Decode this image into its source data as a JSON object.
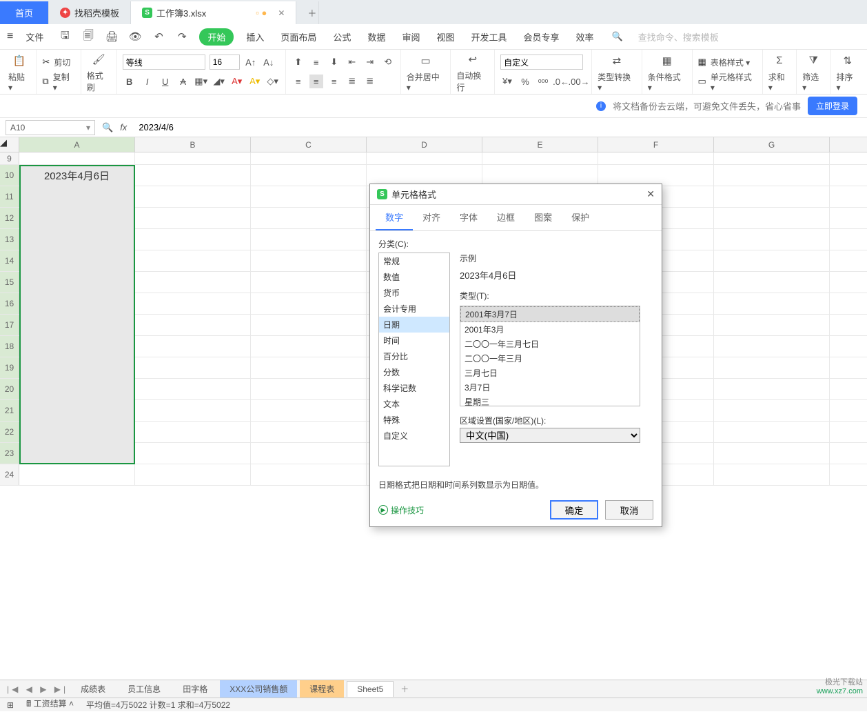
{
  "tabs": {
    "home": "首页",
    "templates": "找稻壳模板",
    "workbook": "工作簿3.xlsx"
  },
  "menubar": {
    "file": "文件",
    "items": [
      "开始",
      "插入",
      "页面布局",
      "公式",
      "数据",
      "审阅",
      "视图",
      "开发工具",
      "会员专享",
      "效率"
    ],
    "search_placeholder": "查找命令、搜索模板"
  },
  "ribbon": {
    "paste": "粘贴",
    "cut": "剪切",
    "copy": "复制",
    "format_painter": "格式刷",
    "font_name": "等线",
    "font_size": "16",
    "merge": "合并居中",
    "wrap": "自动换行",
    "number_format": "自定义",
    "type_convert": "类型转换",
    "cond_format": "条件格式",
    "table_style": "表格样式",
    "cell_style": "单元格样式",
    "sum": "求和",
    "filter": "筛选",
    "sort": "排序"
  },
  "banner": {
    "text": "将文档备份去云端，可避免文件丢失，省心省事",
    "login": "立即登录"
  },
  "fxbar": {
    "name": "A10",
    "formula": "2023/4/6"
  },
  "grid": {
    "columns": [
      "A",
      "B",
      "C",
      "D",
      "E",
      "F",
      "G"
    ],
    "rows": [
      9,
      10,
      11,
      12,
      13,
      14,
      15,
      16,
      17,
      18,
      19,
      20,
      21,
      22,
      23,
      24
    ],
    "a10_value": "2023年4月6日"
  },
  "dialog": {
    "title": "单元格格式",
    "tabs": [
      "数字",
      "对齐",
      "字体",
      "边框",
      "图案",
      "保护"
    ],
    "category_label": "分类(C):",
    "categories": [
      "常规",
      "数值",
      "货币",
      "会计专用",
      "日期",
      "时间",
      "百分比",
      "分数",
      "科学记数",
      "文本",
      "特殊",
      "自定义"
    ],
    "selected_category": "日期",
    "sample_label": "示例",
    "sample_value": "2023年4月6日",
    "type_label": "类型(T):",
    "types": [
      "2001年3月7日",
      "2001年3月",
      "二〇〇一年三月七日",
      "二〇〇一年三月",
      "三月七日",
      "3月7日",
      "星期三"
    ],
    "selected_type": "2001年3月7日",
    "locale_label": "区域设置(国家/地区)(L):",
    "locale_value": "中文(中国)",
    "note": "日期格式把日期和时间系列数显示为日期值。",
    "tips": "操作技巧",
    "ok": "确定",
    "cancel": "取消"
  },
  "sheettabs": {
    "tabs": [
      "成绩表",
      "员工信息",
      "田字格",
      "XXX公司销售额",
      "课程表",
      "Sheet5"
    ],
    "active": "Sheet5"
  },
  "statusbar": {
    "calc": "工资结算",
    "stats": "平均值=4万5022  计数=1  求和=4万5022"
  },
  "logo": {
    "l1": "极光下载站",
    "l2": "www.xz7.com"
  }
}
